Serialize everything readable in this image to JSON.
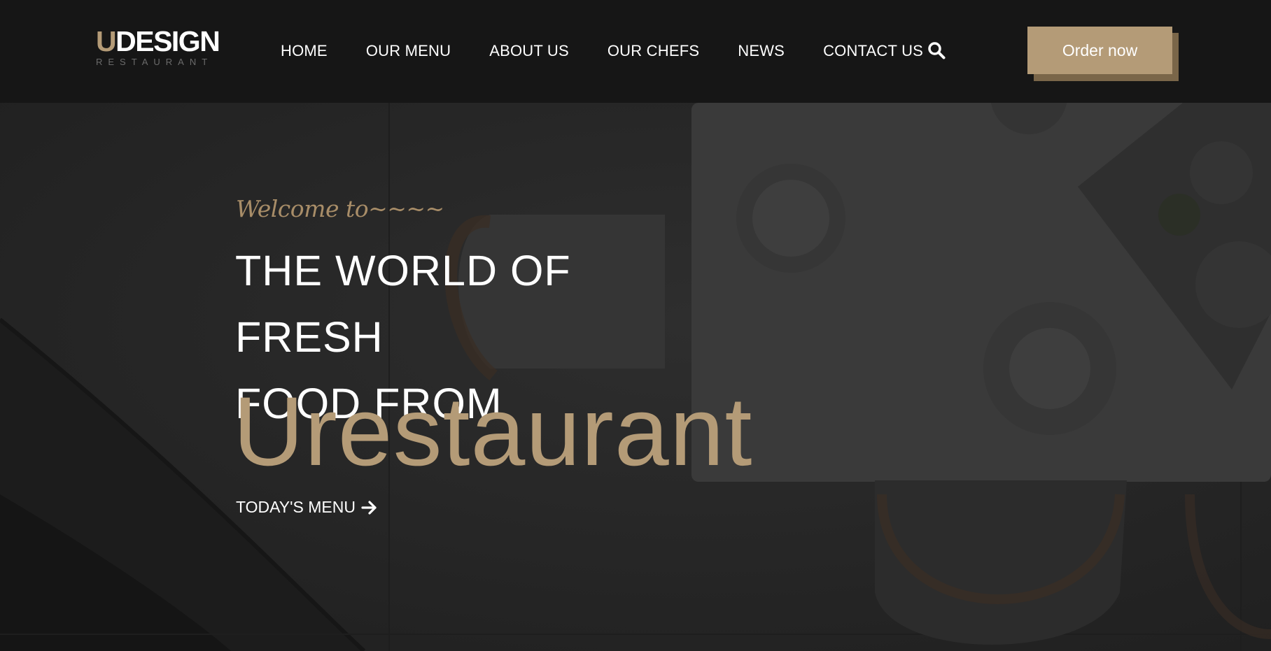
{
  "logo": {
    "letter": "U",
    "rest": "DESIGN",
    "sub": "RESTAURANT"
  },
  "nav": {
    "items": [
      "HOME",
      "OUR MENU",
      "ABOUT US",
      "OUR CHEFS",
      "NEWS",
      "CONTACT US"
    ],
    "search_icon": "search-icon"
  },
  "header": {
    "order_label": "Order now"
  },
  "hero": {
    "welcome": "Welcome to~~~~",
    "headline_line1": "THE WORLD OF FRESH",
    "headline_line2": "FOOD FROM",
    "brand": "Urestaurant",
    "menu_link": "TODAY'S MENU",
    "menu_link_icon": "arrow-right-icon"
  },
  "colors": {
    "accent": "#b49b77",
    "accent_shadow": "#7a6649",
    "header_bg": "#161616",
    "hero_bg": "#262626",
    "text": "#ffffff"
  }
}
